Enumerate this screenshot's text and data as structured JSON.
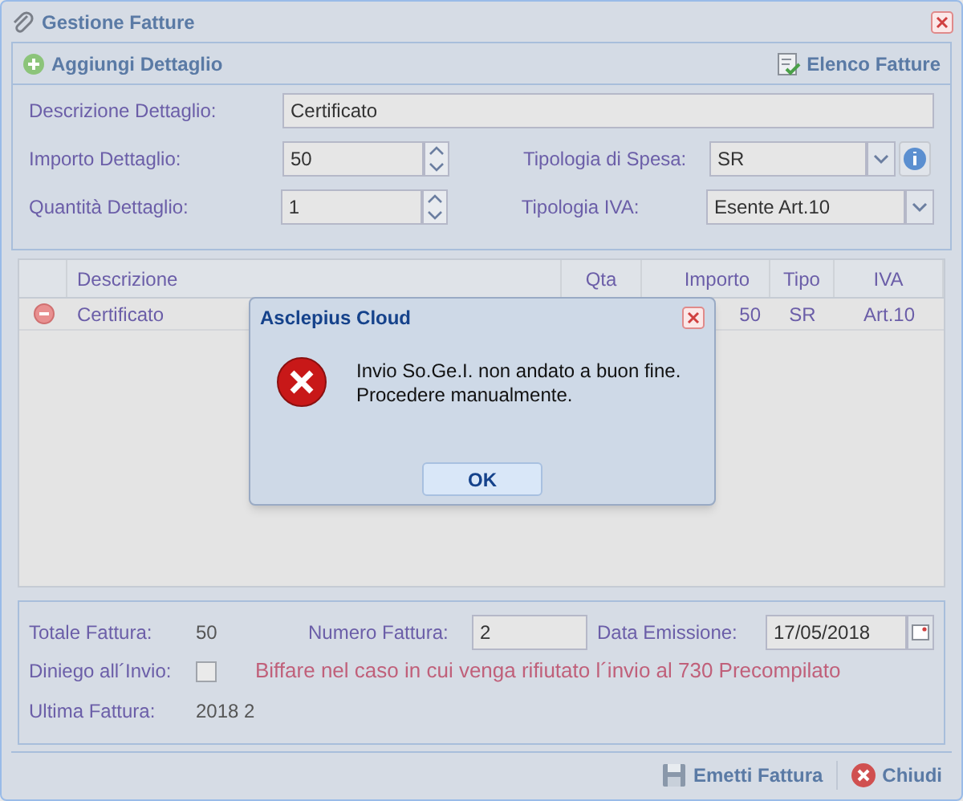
{
  "window": {
    "title": "Gestione Fatture"
  },
  "toolbar": {
    "add_button": "Aggiungi Dettaglio",
    "list_button": "Elenco Fatture"
  },
  "form": {
    "description": {
      "label": "Descrizione Dettaglio:",
      "value": "Certificato"
    },
    "amount": {
      "label": "Importo Dettaglio:",
      "value": "50"
    },
    "quantity": {
      "label": "Quantità Dettaglio:",
      "value": "1"
    },
    "expense_type": {
      "label": "Tipologia di Spesa:",
      "value": "SR"
    },
    "vat_type": {
      "label": "Tipologia IVA:",
      "value": "Esente Art.10"
    }
  },
  "table": {
    "columns": [
      "Descrizione",
      "Qta",
      "Importo",
      "Tipo",
      "IVA"
    ],
    "rows": [
      {
        "descrizione": "Certificato",
        "importo": "50",
        "tipo": "SR",
        "iva": "Art.10"
      }
    ]
  },
  "summary": {
    "total_label": "Totale Fattura:",
    "total": "50",
    "number_label": "Numero Fattura:",
    "number": "2",
    "date_label": "Data Emissione:",
    "date": "17/05/2018",
    "denial_label": "Diniego all´Invio:",
    "denial_checked": false,
    "denial_note": "Biffare nel caso in cui venga rifiutato l´invio al 730 Precompilato",
    "last_label": "Ultima Fattura:",
    "last": "2018 2"
  },
  "footer": {
    "buttons": [
      "Emetti Fattura",
      "Chiudi"
    ]
  },
  "dialog": {
    "title": "Asclepius Cloud",
    "message_lines": [
      "Invio So.Ge.I. non andato a buon fine.",
      "Procedere manualmente."
    ],
    "button": "OK"
  }
}
